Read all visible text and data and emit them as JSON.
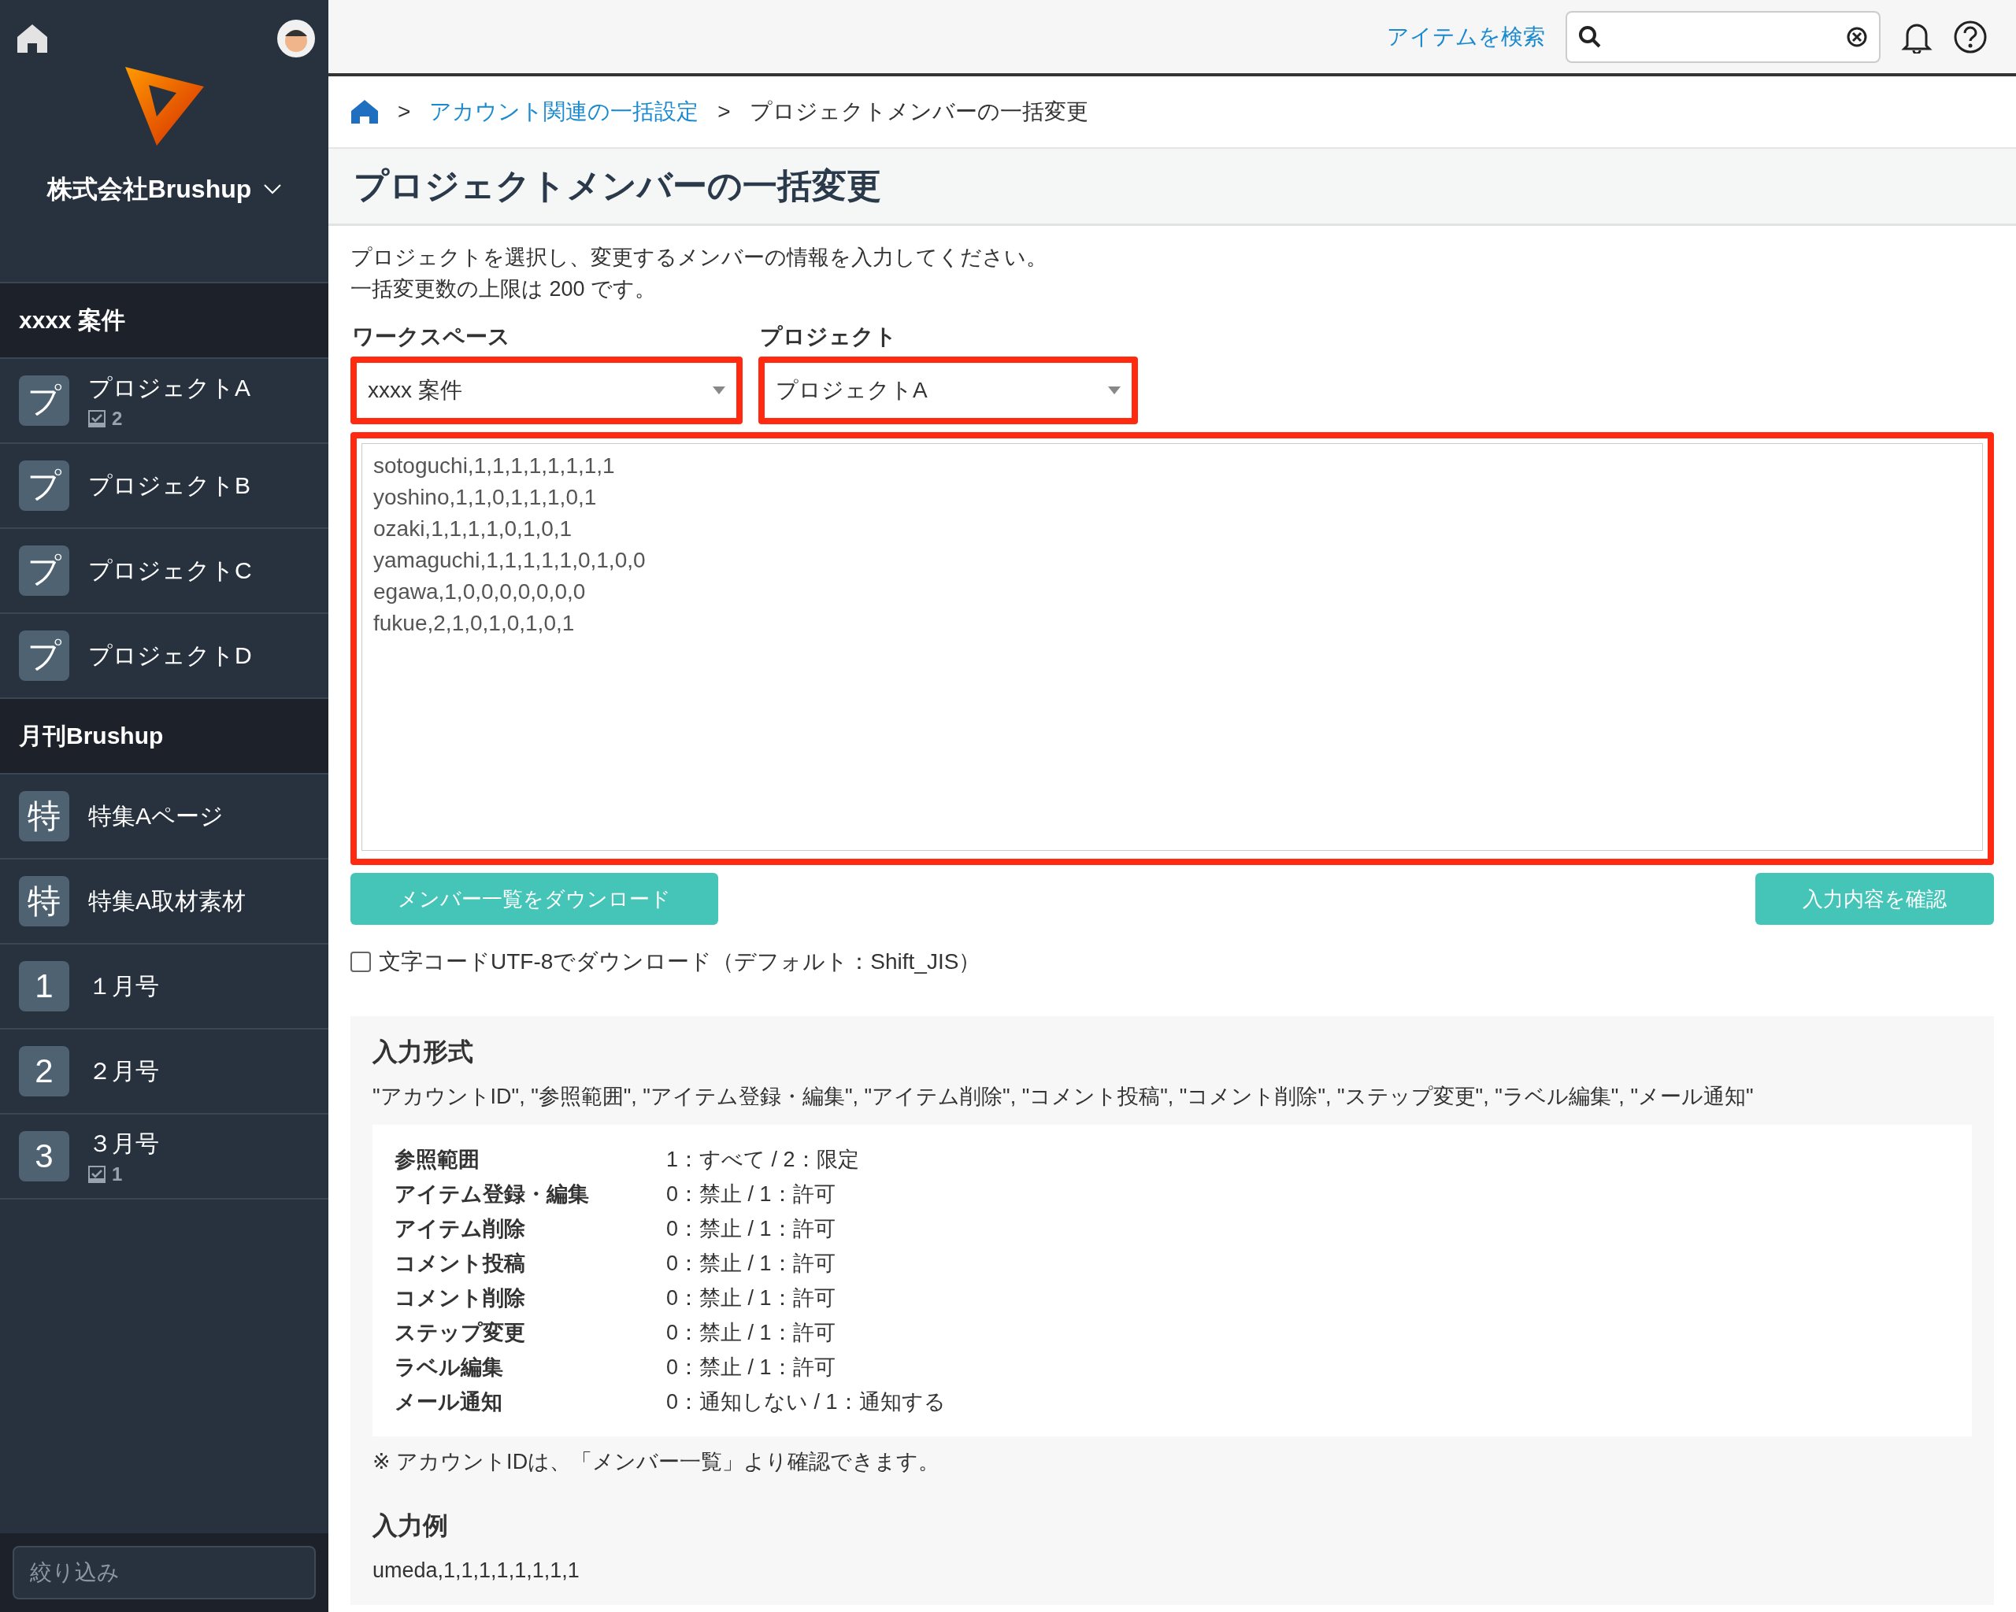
{
  "sidebar": {
    "company": "株式会社Brushup",
    "sections": [
      {
        "title": "xxxx 案件",
        "items": [
          {
            "tile": "プ",
            "name": "プロジェクトA",
            "count": "2"
          },
          {
            "tile": "プ",
            "name": "プロジェクトB"
          },
          {
            "tile": "プ",
            "name": "プロジェクトC"
          },
          {
            "tile": "プ",
            "name": "プロジェクトD"
          }
        ]
      },
      {
        "title": "月刊Brushup",
        "items": [
          {
            "tile": "特",
            "name": "特集Aページ"
          },
          {
            "tile": "特",
            "name": "特集A取材素材"
          },
          {
            "tile": "1",
            "name": "１月号"
          },
          {
            "tile": "2",
            "name": "２月号"
          },
          {
            "tile": "3",
            "name": "３月号",
            "count": "1"
          }
        ]
      }
    ],
    "filter": {
      "placeholder": "絞り込み"
    }
  },
  "topbar": {
    "search_link": "アイテムを検索"
  },
  "breadcrumb": [
    {
      "separator": ">",
      "label": "アカウント関連の一括設定",
      "link": true
    },
    {
      "separator": ">",
      "label": "プロジェクトメンバーの一括変更",
      "link": false
    }
  ],
  "title": "プロジェクトメンバーの一括変更",
  "intro": [
    "プロジェクトを選択し、変更するメンバーの情報を入力してください。",
    "一括変更数の上限は 200 です。"
  ],
  "selects": [
    {
      "label": "ワークスペース",
      "value": "xxxx 案件"
    },
    {
      "label": "プロジェクト",
      "value": "プロジェクトA"
    }
  ],
  "member_input": {
    "value": "sotoguchi,1,1,1,1,1,1,1,1\nyoshino,1,1,0,1,1,1,0,1\nozaki,1,1,1,1,0,1,0,1\nyamaguchi,1,1,1,1,1,0,1,0,0\negawa,1,0,0,0,0,0,0,0\nfukue,2,1,0,1,0,1,0,1"
  },
  "buttons": [
    {
      "label": "メンバー一覧をダウンロード"
    },
    {
      "label": "入力内容を確認"
    }
  ],
  "utf8_option": {
    "label": "文字コードUTF-8でダウンロード（デフォルト：Shift_JIS）",
    "checked": false
  },
  "format": {
    "title": "入力形式",
    "columns": "\"アカウントID\", \"参照範囲\", \"アイテム登録・編集\", \"アイテム削除\", \"コメント投稿\", \"コメント削除\", \"ステップ変更\", \"ラベル編集\", \"メール通知\"",
    "rows": [
      {
        "label": "参照範囲",
        "value": "1：すべて / 2：限定"
      },
      {
        "label": "アイテム登録・編集",
        "value": "0：禁止 / 1：許可"
      },
      {
        "label": "アイテム削除",
        "value": "0：禁止 / 1：許可"
      },
      {
        "label": "コメント投稿",
        "value": "0：禁止 / 1：許可"
      },
      {
        "label": "コメント削除",
        "value": "0：禁止 / 1：許可"
      },
      {
        "label": "ステップ変更",
        "value": "0：禁止 / 1：許可"
      },
      {
        "label": "ラベル編集",
        "value": "0：禁止 / 1：許可"
      },
      {
        "label": "メール通知",
        "value": "0：通知しない / 1：通知する"
      }
    ],
    "note": "※ アカウントIDは、「メンバー一覧」より確認できます。"
  },
  "example": {
    "title": "入力例",
    "text": "umeda,1,1,1,1,1,1,1,1"
  }
}
